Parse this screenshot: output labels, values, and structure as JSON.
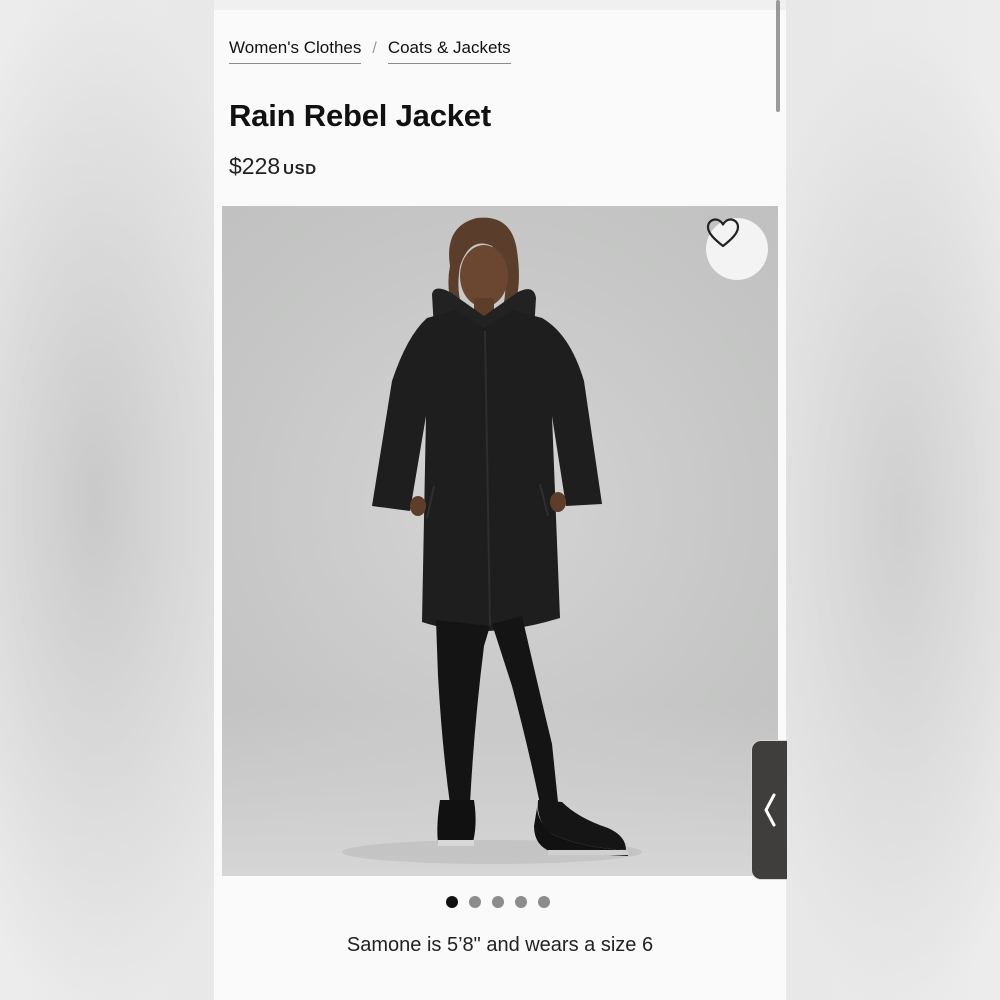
{
  "breadcrumb": {
    "items": [
      {
        "label": "Women's Clothes"
      },
      {
        "label": "Coats & Jackets"
      }
    ],
    "separator": "/"
  },
  "product": {
    "title": "Rain Rebel Jacket",
    "price": "$228",
    "currency": "USD"
  },
  "gallery": {
    "image_count": 5,
    "active_index": 0,
    "favorite_icon": "heart-outline-icon",
    "caption": "Samone is 5’8\" and wears a size 6"
  },
  "side_panel": {
    "icon": "chevron-left-icon"
  },
  "colors": {
    "background": "#fafafa",
    "text": "#111111",
    "dot_active": "#111111",
    "dot_inactive": "#8c8c8c",
    "photo_bg": "#c6c7c6",
    "jacket": "#1e1e1e"
  }
}
